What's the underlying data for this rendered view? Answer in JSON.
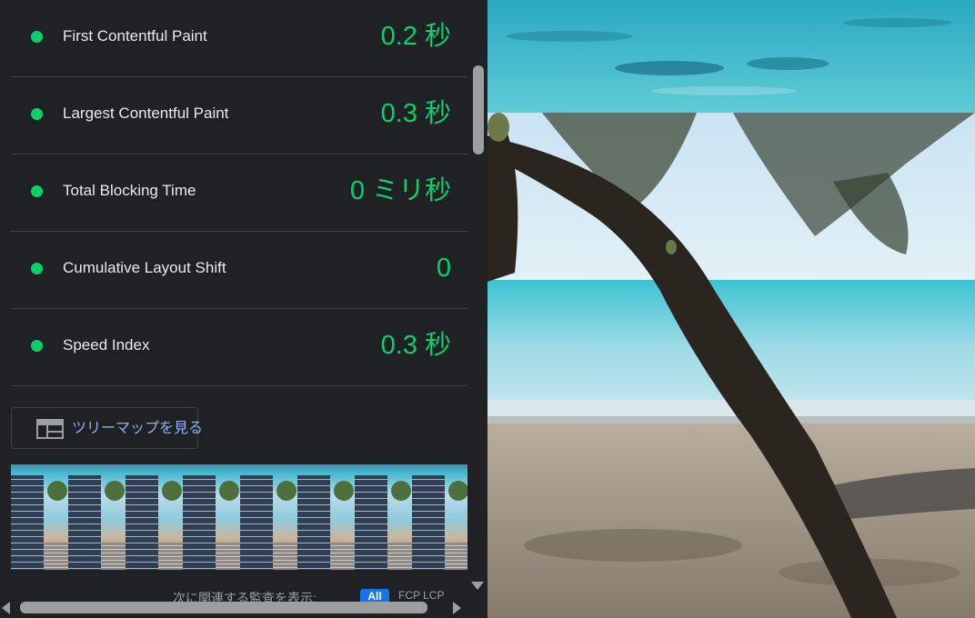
{
  "metrics": [
    {
      "label": "First Contentful Paint",
      "value": "0.2 秒",
      "color": "#0cce6b"
    },
    {
      "label": "Largest Contentful Paint",
      "value": "0.3 秒",
      "color": "#0cce6b"
    },
    {
      "label": "Total Blocking Time",
      "value": "0 ミリ秒",
      "color": "#0cce6b"
    },
    {
      "label": "Cumulative Layout Shift",
      "value": "0",
      "color": "#0cce6b"
    },
    {
      "label": "Speed Index",
      "value": "0.3 秒",
      "color": "#0cce6b"
    }
  ],
  "treemap_button": {
    "label": "ツリーマップを見る",
    "icon": "treemap-icon"
  },
  "filmstrip": {
    "frame_count": 8
  },
  "related_audits": {
    "label": "次に関連する監査を表示:",
    "all_chip": "All",
    "metric_filter": "FCP LCP"
  },
  "photo": {
    "description_icon": "beach-photo",
    "colors": {
      "sea": "#3fb8c9",
      "sky": "#d7ecf5",
      "sand": "#9b8e7c",
      "trunk": "#2b2520"
    }
  }
}
